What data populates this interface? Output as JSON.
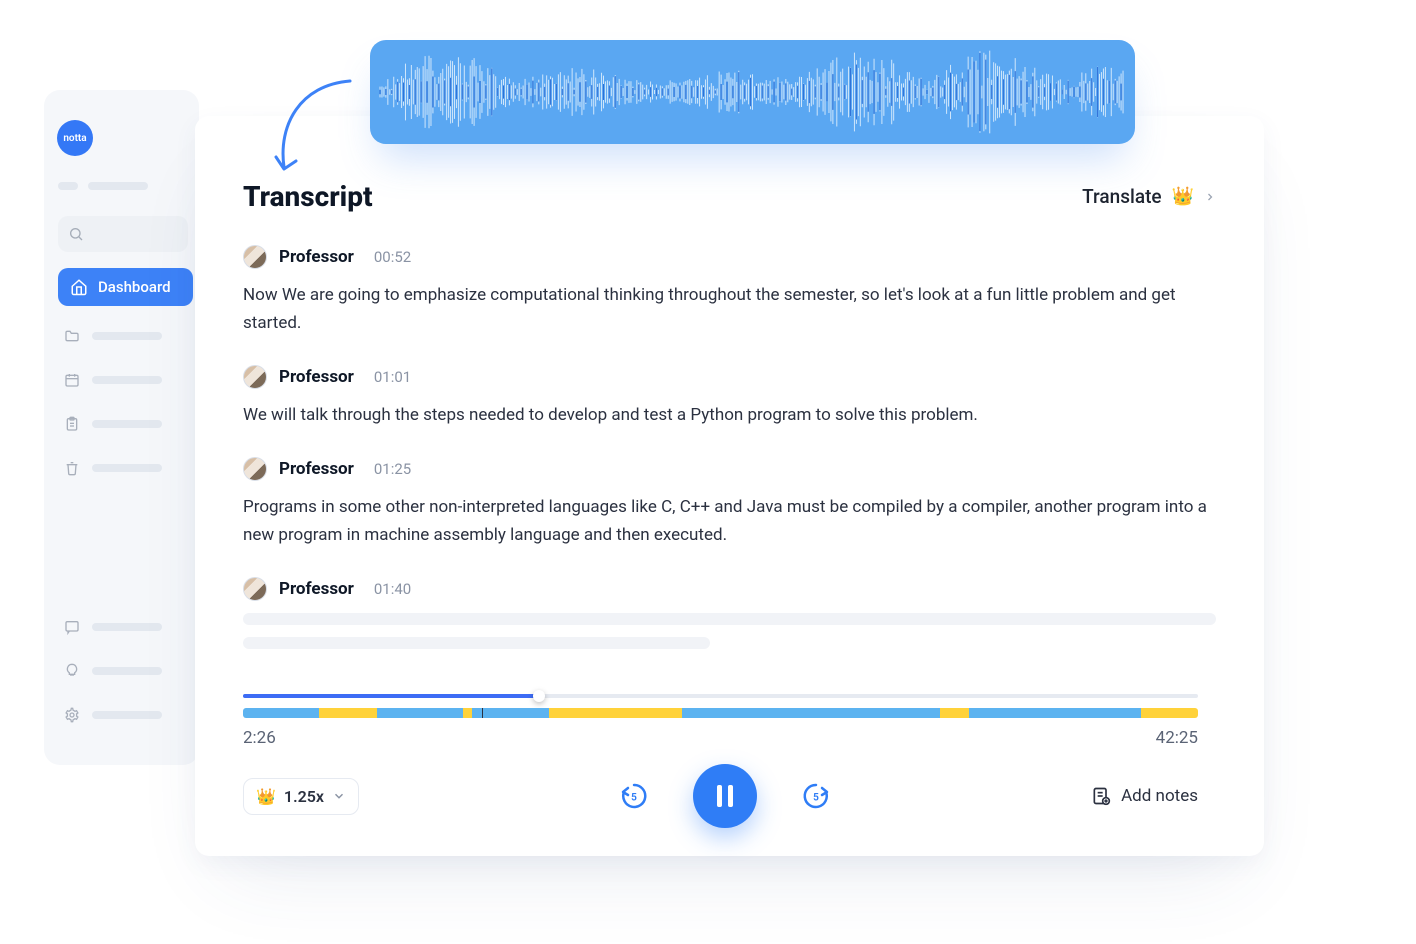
{
  "brand": {
    "name": "notta"
  },
  "sidebar": {
    "active_label": "Dashboard"
  },
  "header": {
    "title": "Transcript",
    "translate_label": "Translate"
  },
  "entries": [
    {
      "speaker": "Professor",
      "time": "00:52",
      "text": "Now We are going to emphasize computational thinking throughout the semester, so let's look at a fun little problem and get started."
    },
    {
      "speaker": "Professor",
      "time": "01:01",
      "text": "We will talk through the steps needed to develop and test a Python program to solve this problem."
    },
    {
      "speaker": "Professor",
      "time": "01:25",
      "text": "Programs in some other non-interpreted languages like C, C++ and Java must be compiled by a compiler, another program into a new program in machine assembly language and then executed."
    },
    {
      "speaker": "Professor",
      "time": "01:40",
      "text": ""
    }
  ],
  "player": {
    "current_time": "2:26",
    "total_time": "42:25",
    "progress_percent": 31,
    "speed_label": "1.25x",
    "skip_seconds": "5",
    "add_notes_label": "Add notes",
    "segments": [
      {
        "c": "b",
        "w": 8
      },
      {
        "c": "y",
        "w": 6
      },
      {
        "c": "b",
        "w": 9
      },
      {
        "c": "y",
        "w": 1
      },
      {
        "c": "b",
        "w": 8
      },
      {
        "c": "y",
        "w": 14
      },
      {
        "c": "b",
        "w": 27
      },
      {
        "c": "y",
        "w": 3
      },
      {
        "c": "b",
        "w": 18
      },
      {
        "c": "y",
        "w": 6
      }
    ],
    "segment_marker_percent": 25
  }
}
